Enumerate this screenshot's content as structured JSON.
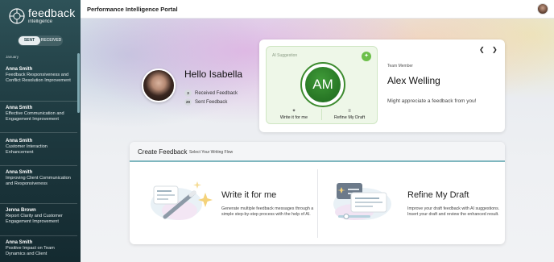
{
  "app": {
    "logo_title": "feedback",
    "logo_subtitle": "intelligence",
    "header_title": "Performance Intelligence Portal"
  },
  "sidebar": {
    "tabs": [
      {
        "label": "SENT",
        "active": true
      },
      {
        "label": "RECEIVED",
        "active": false
      }
    ],
    "month": "January",
    "items": [
      {
        "name": "Anna Smith",
        "title": "Feedback Responsiveness and Conflict Resolution Improvement"
      },
      {
        "name": "Anna Smith",
        "title": "Effective Communication and Engagement Improvement"
      },
      {
        "name": "Anna Smith",
        "title": "Customer Interaction Enhancement"
      },
      {
        "name": "Anna Smith",
        "title": "Improving Client Communication and Responsiveness"
      },
      {
        "name": "Jenna Brown",
        "title": "Report Clarity and Customer Engagement Improvement"
      },
      {
        "name": "Anna Smith",
        "title": "Positive Impact on Team Dynamics and Client"
      }
    ]
  },
  "profile": {
    "greeting": "Hello Isabella",
    "received_count": "3",
    "received_label": "Received Feedback",
    "sent_count": "20",
    "sent_label": "Sent Feedback"
  },
  "ai_suggestion": {
    "label": "AI Suggestion",
    "initials": "AM",
    "write_label": "Write it for me",
    "refine_label": "Refine My Draft",
    "team_member_label": "Team Member",
    "member_name": "Alex Welling",
    "message": "Might appreciate a feedback from you!",
    "prev_icon": "chevron-left-icon",
    "next_icon": "chevron-right-icon"
  },
  "create_feedback": {
    "title": "Create Feedback",
    "subtitle": "Select Your Writing Flow",
    "options": [
      {
        "title": "Write it for me",
        "description": "Generate multiple feedback messages through a simple step-by-step process with the help of AI."
      },
      {
        "title": "Refine My Draft",
        "description": "Improve your draft feedback with AI suggestions. Insert your draft and review the enhanced result."
      }
    ]
  },
  "colors": {
    "sidebar_bg": "#1e3a40",
    "accent_green": "#2a7a27",
    "accent_teal": "#7fb7bf"
  }
}
